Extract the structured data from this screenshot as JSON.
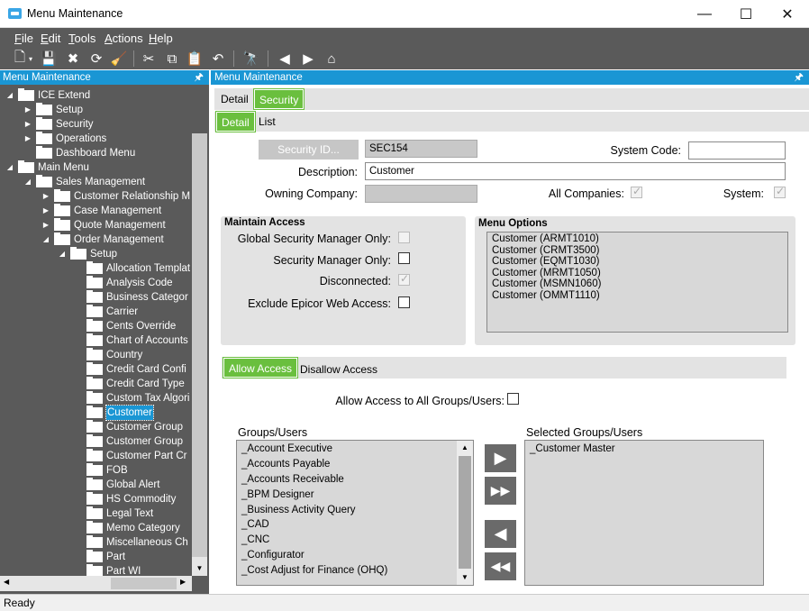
{
  "window": {
    "title": "Menu Maintenance",
    "minimize": "—",
    "maximize": "☐",
    "close": "✕"
  },
  "menubar": [
    {
      "label": "File",
      "u": "F",
      "rest": "ile"
    },
    {
      "label": "Edit",
      "u": "E",
      "rest": "dit"
    },
    {
      "label": "Tools",
      "u": "T",
      "rest": "ools"
    },
    {
      "label": "Actions",
      "u": "A",
      "rest": "ctions"
    },
    {
      "label": "Help",
      "u": "H",
      "rest": "elp"
    }
  ],
  "left_panel": {
    "title": "Menu Maintenance",
    "tree": [
      {
        "label": "ICE Extend",
        "level": 0,
        "arrow": "open",
        "folder": true
      },
      {
        "label": "Setup",
        "level": 1,
        "arrow": "closed",
        "folder": true
      },
      {
        "label": "Security",
        "level": 1,
        "arrow": "closed",
        "folder": true
      },
      {
        "label": "Operations",
        "level": 1,
        "arrow": "closed",
        "folder": true
      },
      {
        "label": "Dashboard Menu",
        "level": 1,
        "arrow": "none",
        "folder": true
      },
      {
        "label": "Main Menu",
        "level": 0,
        "arrow": "open",
        "folder": true
      },
      {
        "label": "Sales Management",
        "level": 1,
        "arrow": "open",
        "folder": true
      },
      {
        "label": "Customer Relationship M",
        "level": 2,
        "arrow": "closed",
        "folder": true
      },
      {
        "label": "Case Management",
        "level": 2,
        "arrow": "closed",
        "folder": true
      },
      {
        "label": "Quote Management",
        "level": 2,
        "arrow": "closed",
        "folder": true
      },
      {
        "label": "Order Management",
        "level": 2,
        "arrow": "open",
        "folder": true
      },
      {
        "label": "Setup",
        "level": 3,
        "arrow": "open",
        "folder": true
      },
      {
        "label": "Allocation Templat",
        "level": 4,
        "arrow": "none",
        "folder": true
      },
      {
        "label": "Analysis Code",
        "level": 4,
        "arrow": "none",
        "folder": true
      },
      {
        "label": "Business Categor",
        "level": 4,
        "arrow": "none",
        "folder": true
      },
      {
        "label": "Carrier",
        "level": 4,
        "arrow": "none",
        "folder": true
      },
      {
        "label": "Cents Override",
        "level": 4,
        "arrow": "none",
        "folder": true
      },
      {
        "label": "Chart of Accounts",
        "level": 4,
        "arrow": "none",
        "folder": true
      },
      {
        "label": "Country",
        "level": 4,
        "arrow": "none",
        "folder": true
      },
      {
        "label": "Credit Card Confi",
        "level": 4,
        "arrow": "none",
        "folder": true
      },
      {
        "label": "Credit Card Type",
        "level": 4,
        "arrow": "none",
        "folder": true
      },
      {
        "label": "Custom Tax Algori",
        "level": 4,
        "arrow": "none",
        "folder": true
      },
      {
        "label": "Customer",
        "level": 4,
        "arrow": "none",
        "folder": true,
        "selected": true
      },
      {
        "label": "Customer Group",
        "level": 4,
        "arrow": "none",
        "folder": true
      },
      {
        "label": "Customer Group",
        "level": 4,
        "arrow": "none",
        "folder": true
      },
      {
        "label": "Customer Part Cr",
        "level": 4,
        "arrow": "none",
        "folder": true
      },
      {
        "label": "FOB",
        "level": 4,
        "arrow": "none",
        "folder": true
      },
      {
        "label": "Global Alert",
        "level": 4,
        "arrow": "none",
        "folder": true
      },
      {
        "label": "HS Commodity",
        "level": 4,
        "arrow": "none",
        "folder": true
      },
      {
        "label": "Legal Text",
        "level": 4,
        "arrow": "none",
        "folder": true
      },
      {
        "label": "Memo Category",
        "level": 4,
        "arrow": "none",
        "folder": true
      },
      {
        "label": "Miscellaneous Ch",
        "level": 4,
        "arrow": "none",
        "folder": true
      },
      {
        "label": "Part",
        "level": 4,
        "arrow": "none",
        "folder": true
      },
      {
        "label": "Part WI",
        "level": 4,
        "arrow": "none",
        "folder": true
      }
    ]
  },
  "right_panel": {
    "title": "Menu Maintenance",
    "tabs_top": [
      "Detail",
      "Security"
    ],
    "tabs_sub": [
      "Detail",
      "List"
    ],
    "form": {
      "security_id_button": "Security ID...",
      "security_id_value": "SEC154",
      "description_label": "Description:",
      "description_value": "Customer",
      "owning_company_label": "Owning Company:",
      "owning_company_value": "",
      "system_code_label": "System Code:",
      "system_code_value": "",
      "all_companies_label": "All Companies:",
      "system_label": "System:"
    },
    "maintain_access": {
      "title": "Maintain Access",
      "global_security_label": "Global Security Manager Only:",
      "security_manager_label": "Security Manager Only:",
      "disconnected_label": "Disconnected:",
      "exclude_web_label": "Exclude Epicor Web Access:"
    },
    "menu_options": {
      "title": "Menu Options",
      "items": [
        "Customer (ARMT1010)",
        "Customer (CRMT3500)",
        "Customer (EQMT1030)",
        "Customer (MRMT1050)",
        "Customer (MSMN1060)",
        "Customer (OMMT1110)"
      ]
    },
    "access_tabs": [
      "Allow Access",
      "Disallow Access"
    ],
    "allow_all_label": "Allow Access to All Groups/Users:",
    "groups_label": "Groups/Users",
    "groups": [
      "_Account Executive",
      "_Accounts Payable",
      "_Accounts Receivable",
      "_BPM Designer",
      "_Business Activity Query",
      "_CAD",
      "_CNC",
      "_Configurator",
      "_Cost Adjust for Finance (OHQ)"
    ],
    "selected_label": "Selected Groups/Users",
    "selected": [
      "_Customer Master"
    ]
  },
  "status": "Ready",
  "colors": {
    "accent": "#1a96d4",
    "tab_green": "#6abf3e",
    "chrome": "#5a5a5a"
  }
}
